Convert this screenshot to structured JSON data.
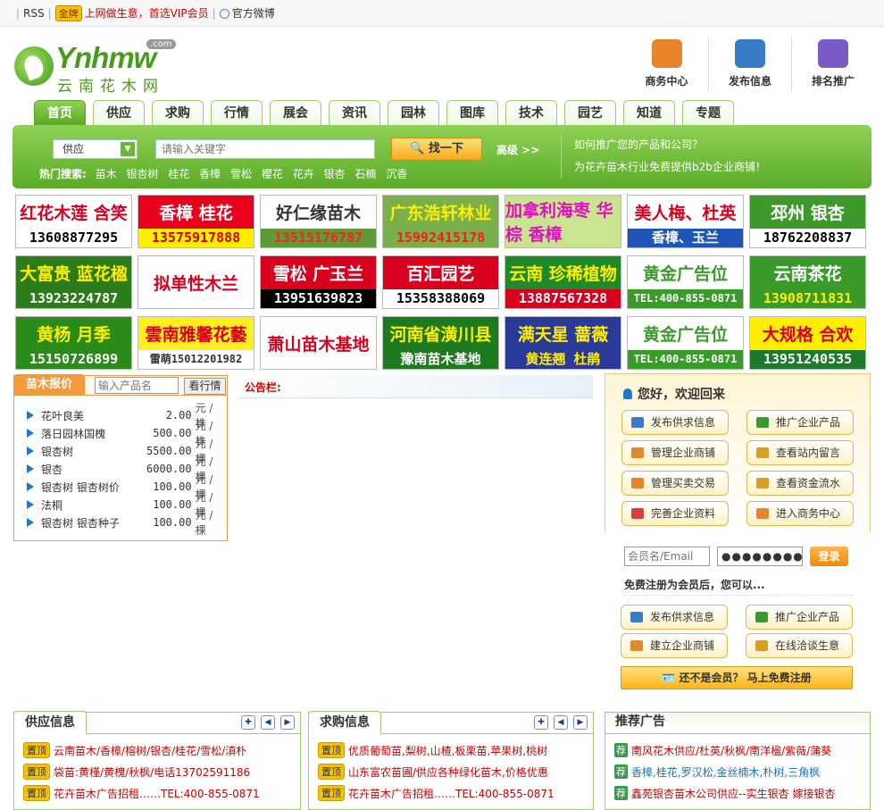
{
  "topbar": {
    "rss": "RSS",
    "gold": "金牌",
    "vip_text": "上网做生意，首选VIP会员",
    "weibo": "官方微博"
  },
  "logo": {
    "en": "Ynhmw",
    "com": ".com",
    "cn": "云南花木网"
  },
  "top_icons": [
    {
      "label": "商务中心",
      "icon": "business-center-icon",
      "color": "#e8842a"
    },
    {
      "label": "发布信息",
      "icon": "publish-icon",
      "color": "#3a7bc8"
    },
    {
      "label": "排名推广",
      "icon": "ranking-icon",
      "color": "#7b5cc7"
    }
  ],
  "nav": [
    "首页",
    "供应",
    "求购",
    "报价",
    "行情",
    "展会",
    "资讯",
    "园林",
    "图库",
    "技术",
    "园艺",
    "知道",
    "专题"
  ],
  "search": {
    "select_value": "供应",
    "placeholder": "请输入关键字",
    "button": "找一下",
    "advanced": "高级 >>",
    "hot_label": "热门搜索:",
    "hot_words": [
      "苗木",
      "银杏树",
      "桂花",
      "香樟",
      "雪松",
      "樱花",
      "花卉",
      "银杏",
      "石楠",
      "沉香"
    ],
    "promo_q": "如何推广您的产品和公司？",
    "promo_a": "为花卉苗木行业免费提供b2b企业商铺！"
  },
  "ads": [
    {
      "title": "红花木莲 含笑",
      "phone": "13608877295",
      "bg": "#ffffff",
      "fg": "#d8001c",
      "pbg": "#ffffff",
      "pfg": "#000000"
    },
    {
      "title": "香樟 桂花",
      "phone": "13575917888",
      "bg": "#e8001c",
      "fg": "#ffffff",
      "pbg": "#ffee00",
      "pfg": "#d00000"
    },
    {
      "title": "好仁缘苗木",
      "phone": "13515176787",
      "bg": "#ffffff",
      "fg": "#333333",
      "pbg": "#5c9a3a",
      "pfg": "#ff2020"
    },
    {
      "title": "广东浩轩林业",
      "phone": "15992415178",
      "bg": "#7ab04a",
      "fg": "#ffee00",
      "pbg": "#7ab04a",
      "pfg": "#ff1a1a"
    },
    {
      "title": "加拿利海枣 华棕 香樟",
      "phone": "",
      "bg": "#c9e58f",
      "fg": "#e010c0",
      "pbg": "#c9e58f",
      "pfg": "#e010c0"
    },
    {
      "title": "美人梅、杜英",
      "phone": "香樟、玉兰",
      "bg": "#ffffff",
      "fg": "#d8001c",
      "pbg": "#1e56b8",
      "pfg": "#ffffff"
    },
    {
      "title": "邳州 银杏",
      "phone": "18762208837",
      "bg": "#3d9a2a",
      "fg": "#ffffff",
      "pbg": "#ffffff",
      "pfg": "#000000"
    },
    {
      "title": "大富贵 蓝花楹",
      "phone": "13923224787",
      "bg": "#2a7d1a",
      "fg": "#ffee00",
      "pbg": "#2a7d1a",
      "pfg": "#ffffff"
    },
    {
      "title": "拟单性木兰",
      "phone": "",
      "bg": "#ffffff",
      "fg": "#d8001c",
      "pbg": "#ffffff",
      "pfg": "#d8001c"
    },
    {
      "title": "雪松 广玉兰",
      "phone": "13951639823",
      "bg": "#d8001c",
      "fg": "#ffffff",
      "pbg": "#000000",
      "pfg": "#ffffff"
    },
    {
      "title": "百汇园艺",
      "phone": "15358388069",
      "bg": "#d8001c",
      "fg": "#ffffff",
      "pbg": "#ffffff",
      "pfg": "#000000"
    },
    {
      "title": "云南 珍稀植物",
      "phone": "13887567328",
      "bg": "#1f8a2a",
      "fg": "#ffee00",
      "pbg": "#d8001c",
      "pfg": "#ffffff"
    },
    {
      "title": "黄金广告位",
      "phone": "TEL:400-855-0871",
      "bg": "#ffffff",
      "fg": "#3a9a2a",
      "pbg": "#3a9a2a",
      "pfg": "#ffffff"
    },
    {
      "title": "云南茶花",
      "phone": "13908711831",
      "bg": "#3a9a2a",
      "fg": "#ffffff",
      "pbg": "#3a9a2a",
      "pfg": "#ffee00"
    },
    {
      "title": "黄杨 月季",
      "phone": "15150726899",
      "bg": "#2a8a1a",
      "fg": "#ffee00",
      "pbg": "#2a8a1a",
      "pfg": "#ffffff"
    },
    {
      "title": "雲南雅馨花藝",
      "phone": "雷萌15012201982",
      "bg": "#ffee22",
      "fg": "#d8001c",
      "pbg": "#ffffff",
      "pfg": "#333333"
    },
    {
      "title": "萧山苗木基地",
      "phone": "",
      "bg": "#ffffff",
      "fg": "#d8001c",
      "pbg": "#ffffff",
      "pfg": "#d8001c"
    },
    {
      "title": "河南省潢川县",
      "phone": "豫南苗木基地",
      "bg": "#1e7a1e",
      "fg": "#ffee00",
      "pbg": "#1e7a1e",
      "pfg": "#ffffff"
    },
    {
      "title": "满天星 蔷薇",
      "phone": "黄连翘 杜鹃",
      "bg": "#2a3a9a",
      "fg": "#ffee00",
      "pbg": "#2a3a9a",
      "pfg": "#ffee00"
    },
    {
      "title": "黄金广告位",
      "phone": "TEL:400-855-0871",
      "bg": "#ffffff",
      "fg": "#3a9a2a",
      "pbg": "#3a9a2a",
      "pfg": "#ffffff"
    },
    {
      "title": "大规格 合欢",
      "phone": "13951240535",
      "bg": "#ffee00",
      "fg": "#d8001c",
      "pbg": "#1e7a2a",
      "pfg": "#ffffff"
    }
  ],
  "price": {
    "title": "苗木报价",
    "placeholder": "输入产品名",
    "button": "看行情",
    "items": [
      {
        "name": "花叶良美",
        "price": "2.00",
        "unit": "元 / 株"
      },
      {
        "name": "落日园林国槐",
        "price": "500.00",
        "unit": "元 / 株"
      },
      {
        "name": "银杏树",
        "price": "5500.00",
        "unit": "元 / 棵"
      },
      {
        "name": "银杏",
        "price": "6000.00",
        "unit": "元 / 棵"
      },
      {
        "name": "银杏树 银杏树价",
        "price": "100.00",
        "unit": "元 / 棵"
      },
      {
        "name": "法桐",
        "price": "100.00",
        "unit": "元 / 棵"
      },
      {
        "name": "银杏树 银杏种子",
        "price": "100.00",
        "unit": "元 / 棵"
      }
    ]
  },
  "notice": {
    "label": "公告栏:"
  },
  "user": {
    "welcome": "您好，欢迎回来",
    "buttons": [
      {
        "label": "发布供求信息",
        "color": "#3a7bc8"
      },
      {
        "label": "推广企业产品",
        "color": "#3a9a2a"
      },
      {
        "label": "管理企业商铺",
        "color": "#e08a2a"
      },
      {
        "label": "查看站内留言",
        "color": "#d8a020"
      },
      {
        "label": "管理买卖交易",
        "color": "#e8842a"
      },
      {
        "label": "查看资金流水",
        "color": "#d8a020"
      },
      {
        "label": "完善企业资料",
        "color": "#d84040"
      },
      {
        "label": "进入商务中心",
        "color": "#e8842a"
      }
    ],
    "login_placeholder": "会员名/Email",
    "password_mask": "●●●●●●●●",
    "login_button": "登录",
    "reg_tip": "免费注册为会员后，您可以...",
    "guest_buttons": [
      {
        "label": "发布供求信息",
        "color": "#3a7bc8"
      },
      {
        "label": "推广企业产品",
        "color": "#3a9a2a"
      },
      {
        "label": "建立企业商铺",
        "color": "#e08a2a"
      },
      {
        "label": "在线洽谈生意",
        "color": "#d8a020"
      }
    ],
    "register": "还不是会员？ 马上免费注册"
  },
  "supply": {
    "title": "供应信息",
    "tag": "置顶",
    "items": [
      "云南苗木/香樟/榕树/银杏/桂花/雪松/滇朴",
      "袋苗:黄槿/黄槐/秋枫/电话13702591186",
      "花卉苗木广告招租……TEL:400-855-0871"
    ]
  },
  "buy": {
    "title": "求购信息",
    "tag": "置顶",
    "items": [
      "优质葡萄苗,梨树,山楂,板栗苗,苹果树,桃树",
      "山东富农苗圃/供应各种绿化苗木,价格优惠",
      "花卉苗木广告招租……TEL:400-855-0871"
    ]
  },
  "recommend": {
    "title": "推荐广告",
    "tag": "荐",
    "items": [
      "南风花木供应/杜英/秋枫/南洋楹/紫薇/蒲葵",
      "香樟,桂花,罗汉松,金丝楠木,朴树,三角枫",
      "鑫苑银杏苗木公司供应--实生银杏 嫁接银杏"
    ]
  },
  "colors": {
    "brand_green": "#5aab28",
    "orange": "#f39a3c",
    "red": "#cc0000"
  }
}
